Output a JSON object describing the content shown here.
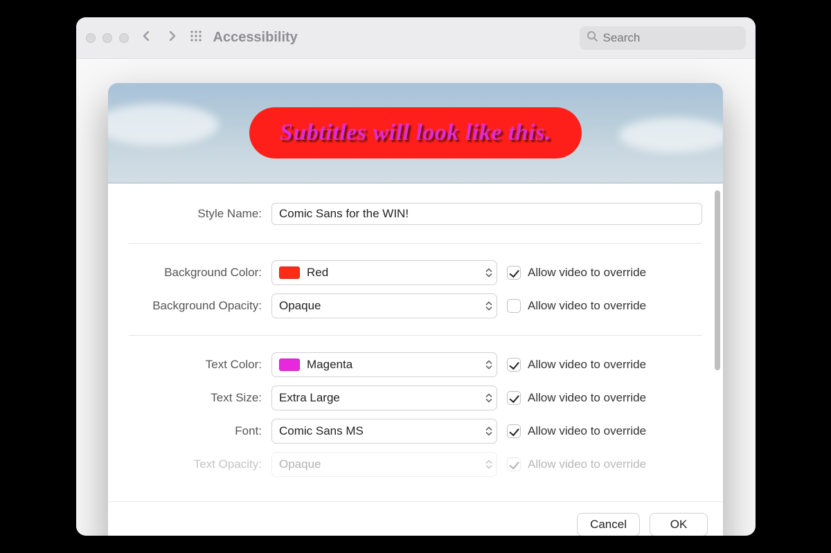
{
  "window": {
    "title": "Accessibility",
    "search_placeholder": "Search"
  },
  "sheet": {
    "preview_text": "Subtitles will look like this.",
    "style_name_label": "Style Name:",
    "style_name_value": "Comic Sans for the WIN!",
    "override_label": "Allow video to override",
    "buttons": {
      "cancel": "Cancel",
      "ok": "OK"
    },
    "rows": {
      "background_color": {
        "label": "Background Color:",
        "value": "Red",
        "override_checked": true
      },
      "background_opacity": {
        "label": "Background Opacity:",
        "value": "Opaque",
        "override_checked": false
      },
      "text_color": {
        "label": "Text Color:",
        "value": "Magenta",
        "override_checked": true
      },
      "text_size": {
        "label": "Text Size:",
        "value": "Extra Large",
        "override_checked": true
      },
      "font": {
        "label": "Font:",
        "value": "Comic Sans MS",
        "override_checked": true
      },
      "text_opacity": {
        "label": "Text Opacity:",
        "value": "Opaque",
        "override_checked": true
      }
    },
    "colors": {
      "sample_background": "#ff1f1a",
      "sample_text": "#e02bd9"
    }
  }
}
